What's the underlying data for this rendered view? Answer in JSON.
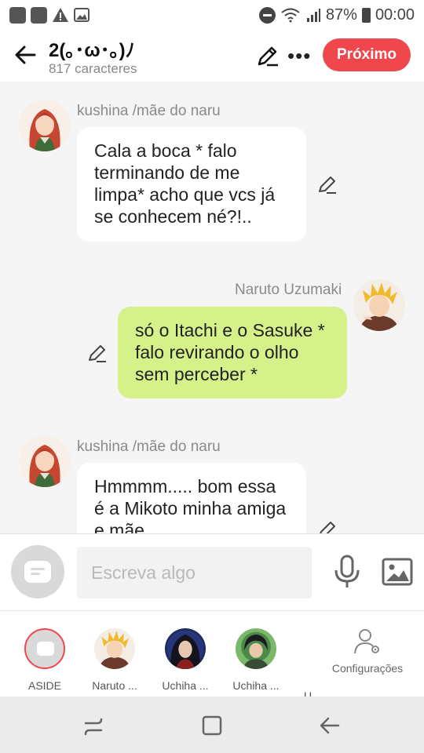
{
  "status_bar": {
    "battery": "87%",
    "time": "00:00"
  },
  "header": {
    "title": "2(｡･ω･｡)ﾉ",
    "subtitle": "817 caracteres",
    "next_label": "Próximo"
  },
  "messages": [
    {
      "sender": "kushina /mãe do naru",
      "text": "Cala a boca * falo terminando de me limpa* acho que vcs já se conhecem né?!..",
      "side": "left"
    },
    {
      "sender": "Naruto Uzumaki",
      "text": "só o Itachi e o Sasuke * falo revirando o olho sem perceber *",
      "side": "right"
    },
    {
      "sender": "kushina /mãe do naru",
      "text": "Hmmmm..... bom essa é a Mikoto minha amiga e mãe",
      "side": "left"
    }
  ],
  "input": {
    "placeholder": "Escreva algo"
  },
  "characters": [
    {
      "label": "ASIDE"
    },
    {
      "label": "Naruto ..."
    },
    {
      "label": "Uchiha ..."
    },
    {
      "label": "Uchiha ..."
    },
    {
      "label": "U"
    }
  ],
  "settings_label": "Configurações",
  "colors": {
    "accent": "#f0474c",
    "green_bubble": "#d5f18a"
  }
}
